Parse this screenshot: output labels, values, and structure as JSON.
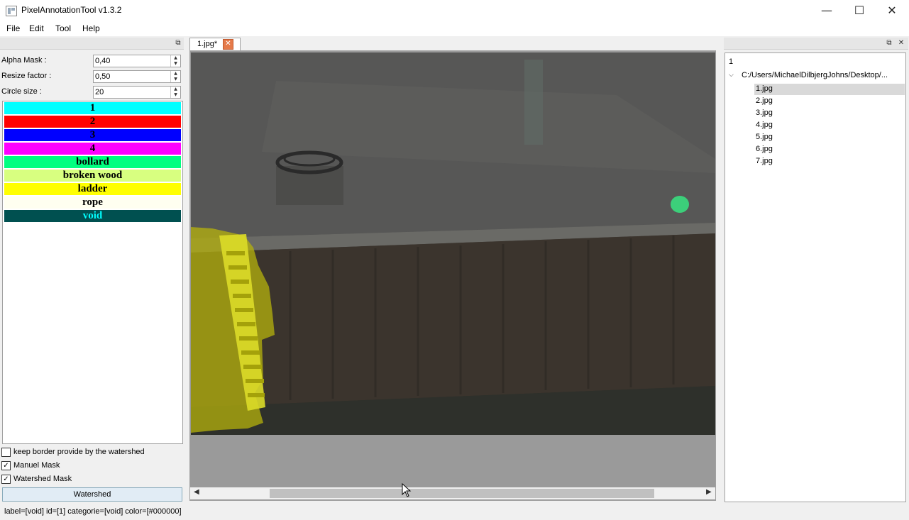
{
  "window": {
    "title": "PixelAnnotationTool v1.3.2",
    "minimize": "—",
    "maximize": "☐",
    "close": "✕"
  },
  "menu": [
    "File",
    "Edit",
    "Tool",
    "Help"
  ],
  "params": {
    "alpha_label": "Alpha Mask :",
    "alpha_value": "0,40",
    "resize_label": "Resize factor :",
    "resize_value": "0,50",
    "circle_label": "Circle size :",
    "circle_value": "20"
  },
  "labels": [
    {
      "name": "1",
      "bg": "#00ffff",
      "fg": "#000000"
    },
    {
      "name": "2",
      "bg": "#ff0000",
      "fg": "#000000"
    },
    {
      "name": "3",
      "bg": "#0000ff",
      "fg": "#000000"
    },
    {
      "name": "4",
      "bg": "#ff00ff",
      "fg": "#000000"
    },
    {
      "name": "bollard",
      "bg": "#00ff80",
      "fg": "#000000"
    },
    {
      "name": "broken wood",
      "bg": "#d8ff80",
      "fg": "#000000"
    },
    {
      "name": "ladder",
      "bg": "#ffff00",
      "fg": "#000000"
    },
    {
      "name": "rope",
      "bg": "#fffff0",
      "fg": "#000000"
    },
    {
      "name": "void",
      "bg": "#005050",
      "fg": "#00ffff"
    }
  ],
  "options": {
    "keep_border": {
      "label": "keep border provide by the watershed",
      "checked": false
    },
    "manuel_mask": {
      "label": "Manuel Mask",
      "checked": true
    },
    "watershed_mask": {
      "label": "Watershed Mask",
      "checked": true
    }
  },
  "watershed_button": "Watershed",
  "tab": {
    "label": "1.jpg*",
    "close": "✕"
  },
  "tree": {
    "root": "1",
    "folder": "C:/Users/MichaelDilbjergJohns/Desktop/...",
    "files": [
      "1.jpg",
      "2.jpg",
      "3.jpg",
      "4.jpg",
      "5.jpg",
      "6.jpg",
      "7.jpg"
    ],
    "selected": "1.jpg"
  },
  "status": "label=[void] id=[1] categorie=[void] color=[#000000]"
}
